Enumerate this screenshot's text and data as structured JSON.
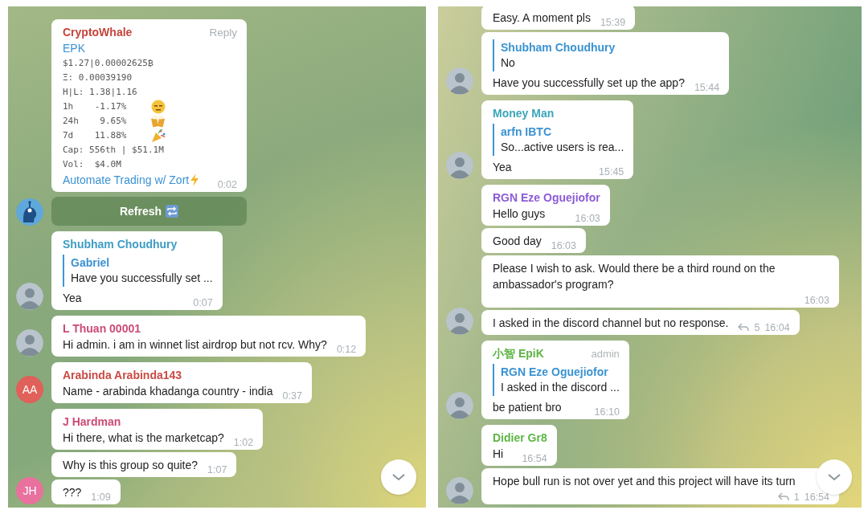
{
  "panels": [
    {
      "groups": [
        {
          "avatar": {
            "kind": "bot"
          },
          "messages": [
            {
              "kind": "card",
              "sender": "CryptoWhale",
              "color": "#c5443a",
              "reply_button": "Reply",
              "title": "EPK",
              "lines": [
                {
                  "text": "$1.27|0.00002625₿",
                  "icon": false
                },
                {
                  "text": "Ξ: 0.00039190",
                  "icon": false
                },
                {
                  "text": "H|L: 1.38|1.16",
                  "icon": false
                },
                {
                  "text": "1h    -1.17%",
                  "icon": true
                },
                {
                  "text": "24h    9.65%",
                  "icon": true
                },
                {
                  "text": "7d    11.88%",
                  "icon": true
                },
                {
                  "text": "Cap: 556th | $51.1M",
                  "icon": false
                },
                {
                  "text": "Vol:  $4.0M",
                  "icon": false
                }
              ],
              "link": "Automate Trading w/ Zort",
              "time": "0:02",
              "keyboard": "Refresh"
            }
          ]
        },
        {
          "avatar": {
            "kind": "photo"
          },
          "messages": [
            {
              "kind": "text",
              "sender": "Shubham Choudhury",
              "color": "#3d9cc4",
              "reply": {
                "name": "Gabriel",
                "text": "Have you successfully set ..."
              },
              "text": "Yea",
              "time": "0:07"
            }
          ]
        },
        {
          "avatar": {
            "kind": "photo"
          },
          "messages": [
            {
              "kind": "text",
              "sender": "L Thuan 00001",
              "color": "#cc4a73",
              "text": "Hi admin. i am in winnet list airdrop but not rcv. Why?",
              "time": "0:12"
            }
          ]
        },
        {
          "avatar": {
            "kind": "initials",
            "text": "AA",
            "color": "#e0605a"
          },
          "messages": [
            {
              "kind": "text",
              "sender": "Arabinda Arabinda143",
              "color": "#c94a44",
              "text": "Name - arabinda khadanga country - india",
              "time": "0:37"
            }
          ]
        },
        {
          "avatar": {
            "kind": "initials",
            "text": "JH",
            "color": "#e8719e"
          },
          "messages": [
            {
              "kind": "text",
              "sender": "J Hardman",
              "color": "#cc4a73",
              "text": "Hi there, what is the marketcap?",
              "time": "1:02"
            },
            {
              "kind": "text",
              "text": "Why is this group so quite?",
              "time": "1:07"
            },
            {
              "kind": "text",
              "text": "???",
              "time": "1:09"
            }
          ]
        }
      ]
    },
    {
      "groups": [
        {
          "avatar": {
            "kind": "photo"
          },
          "messages": [
            {
              "kind": "text",
              "text": "Easy. A moment pls",
              "time": "15:39"
            },
            {
              "kind": "text",
              "reply": {
                "name": "Shubham Choudhury",
                "text": "No"
              },
              "text": "Have you successfully set up the app?",
              "time": "15:44"
            }
          ]
        },
        {
          "avatar": {
            "kind": "photo"
          },
          "messages": [
            {
              "kind": "text",
              "sender": "Money Man",
              "color": "#3aa6b9",
              "reply": {
                "name": "arfn IBTC",
                "text": "So...active users is rea..."
              },
              "text": "Yea",
              "time": "15:45"
            }
          ]
        },
        {
          "avatar": {
            "kind": "photo"
          },
          "messages": [
            {
              "kind": "text",
              "sender": "RGN Eze Oguejiofor",
              "color": "#8c5bd6",
              "text": "Hello guys",
              "time": "16:03"
            },
            {
              "kind": "text",
              "text": "Good day",
              "time": "16:03"
            },
            {
              "kind": "text",
              "text": "Please I wish to ask. Would there be a third round on the ambassador's program?",
              "time": "16:03"
            },
            {
              "kind": "text",
              "text": "I asked in the discord channel but no response.",
              "replies": "5",
              "time": "16:04"
            }
          ]
        },
        {
          "avatar": {
            "kind": "photo"
          },
          "messages": [
            {
              "kind": "text",
              "sender": "小智 EpiK",
              "color": "#5cb544",
              "badge": "admin",
              "reply": {
                "name": "RGN Eze Oguejiofor",
                "text": "I asked in the discord ..."
              },
              "text": "be patient bro",
              "time": "16:10"
            }
          ]
        },
        {
          "avatar": {
            "kind": "photo"
          },
          "messages": [
            {
              "kind": "text",
              "sender": "Didier Gr8",
              "color": "#5cb544",
              "text": "Hi",
              "time": "16:54"
            },
            {
              "kind": "text",
              "text": "Hope bull run is not over yet and this project will have its turn",
              "replies": "1",
              "time": "16:54"
            }
          ]
        }
      ]
    }
  ]
}
